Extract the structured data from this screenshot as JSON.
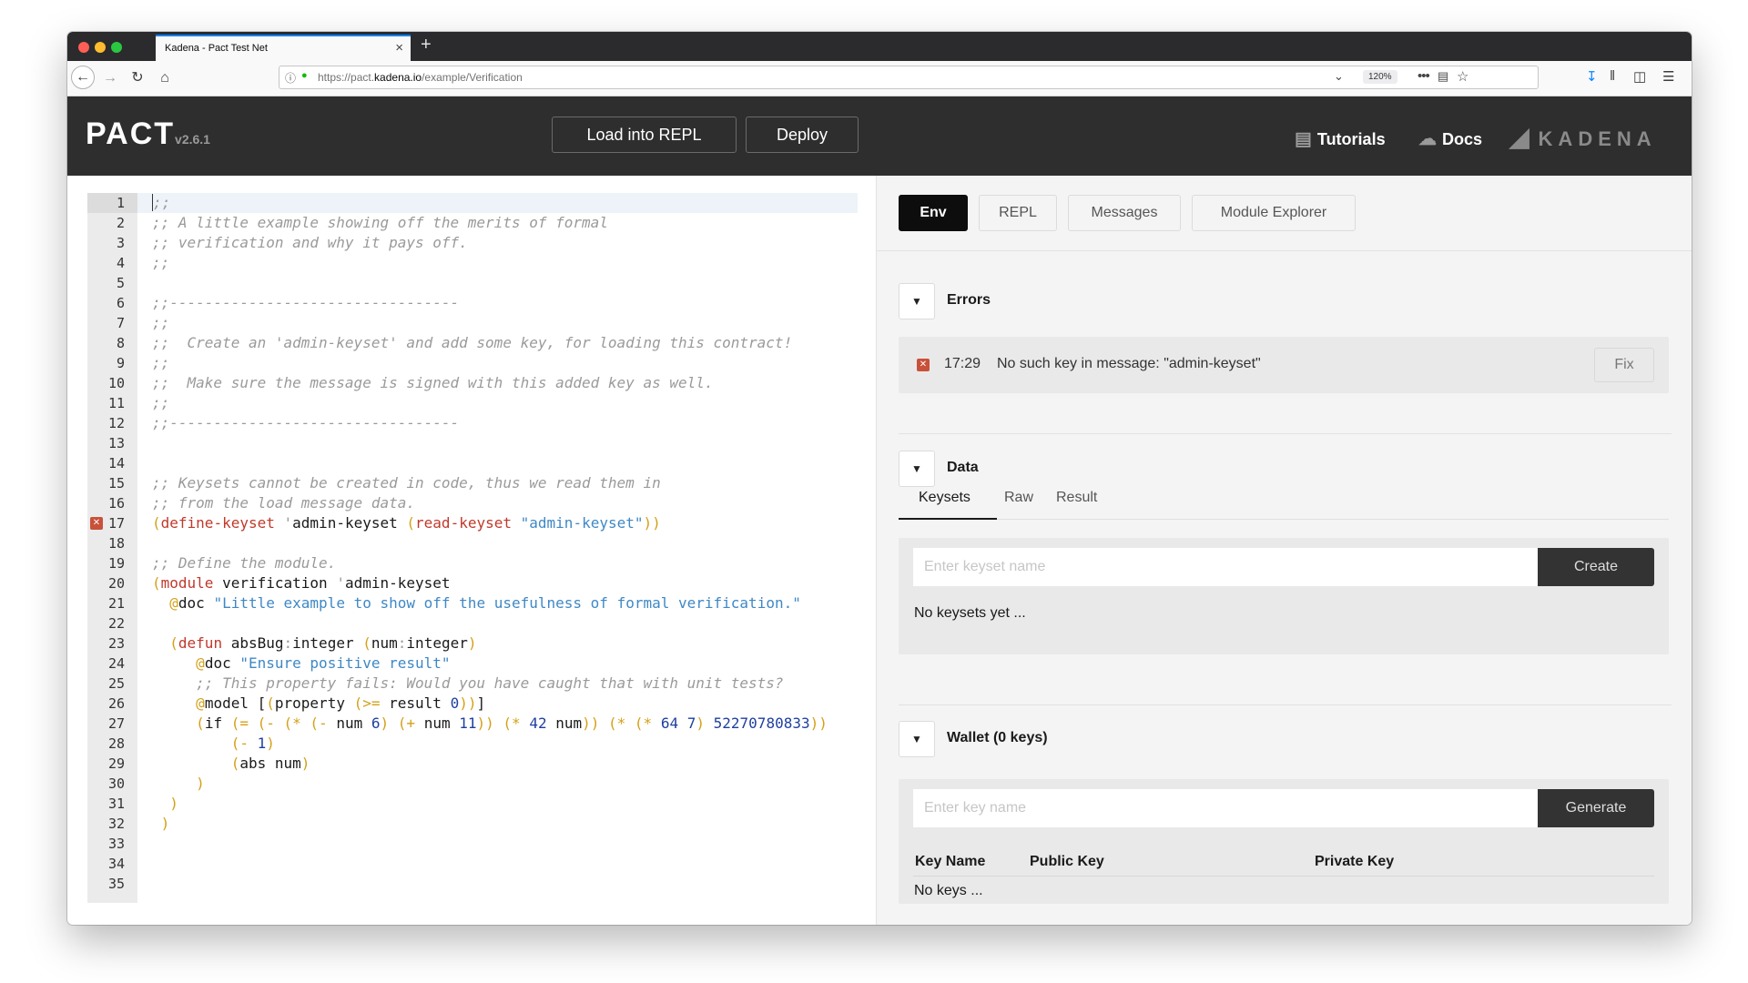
{
  "browser": {
    "tab_title": "Kadena - Pact Test Net",
    "tab_close": "×",
    "new_tab": "+",
    "url_prefix": "https://pact.",
    "url_domain": "kadena.io",
    "url_path": "/example/Verification",
    "zoom": "120%"
  },
  "header": {
    "logo": "PACT",
    "version": "v2.6.1",
    "load_button": "Load into REPL",
    "deploy_button": "Deploy",
    "tutorials_link": "Tutorials",
    "docs_link": "Docs",
    "brand": "KADENA"
  },
  "editor": {
    "line_numbers": [
      "1",
      "2",
      "3",
      "4",
      "5",
      "6",
      "7",
      "8",
      "9",
      "10",
      "11",
      "12",
      "13",
      "14",
      "15",
      "16",
      "17",
      "18",
      "19",
      "20",
      "21",
      "22",
      "23",
      "24",
      "25",
      "26",
      "27",
      "28",
      "29",
      "30",
      "31",
      "32",
      "33",
      "34",
      "35"
    ],
    "error_line": "17"
  },
  "panel": {
    "tabs": [
      "Env",
      "REPL",
      "Messages",
      "Module Explorer"
    ],
    "active_tab": "Env",
    "errors": {
      "title": "Errors",
      "position": "17:29",
      "message": "No such key in message: \"admin-keyset\"",
      "fix_label": "Fix"
    },
    "data": {
      "title": "Data",
      "subtabs": [
        "Keysets",
        "Raw",
        "Result"
      ],
      "active_subtab": "Keysets",
      "keyset_placeholder": "Enter keyset name",
      "create_label": "Create",
      "empty_text": "No keysets yet ..."
    },
    "wallet": {
      "title": "Wallet (0 keys)",
      "key_placeholder": "Enter key name",
      "generate_label": "Generate",
      "columns": [
        "Key Name",
        "Public Key",
        "Private Key"
      ],
      "empty_text": "No keys ..."
    }
  },
  "colors": {
    "header_bg": "#2e2e2e",
    "active_tab_bg": "#0d0d0d",
    "error_red": "#c8513a",
    "keyword": "#c0392b",
    "string": "#3f88c5",
    "paren": "#d4a017",
    "comment": "#9a9a9a"
  }
}
